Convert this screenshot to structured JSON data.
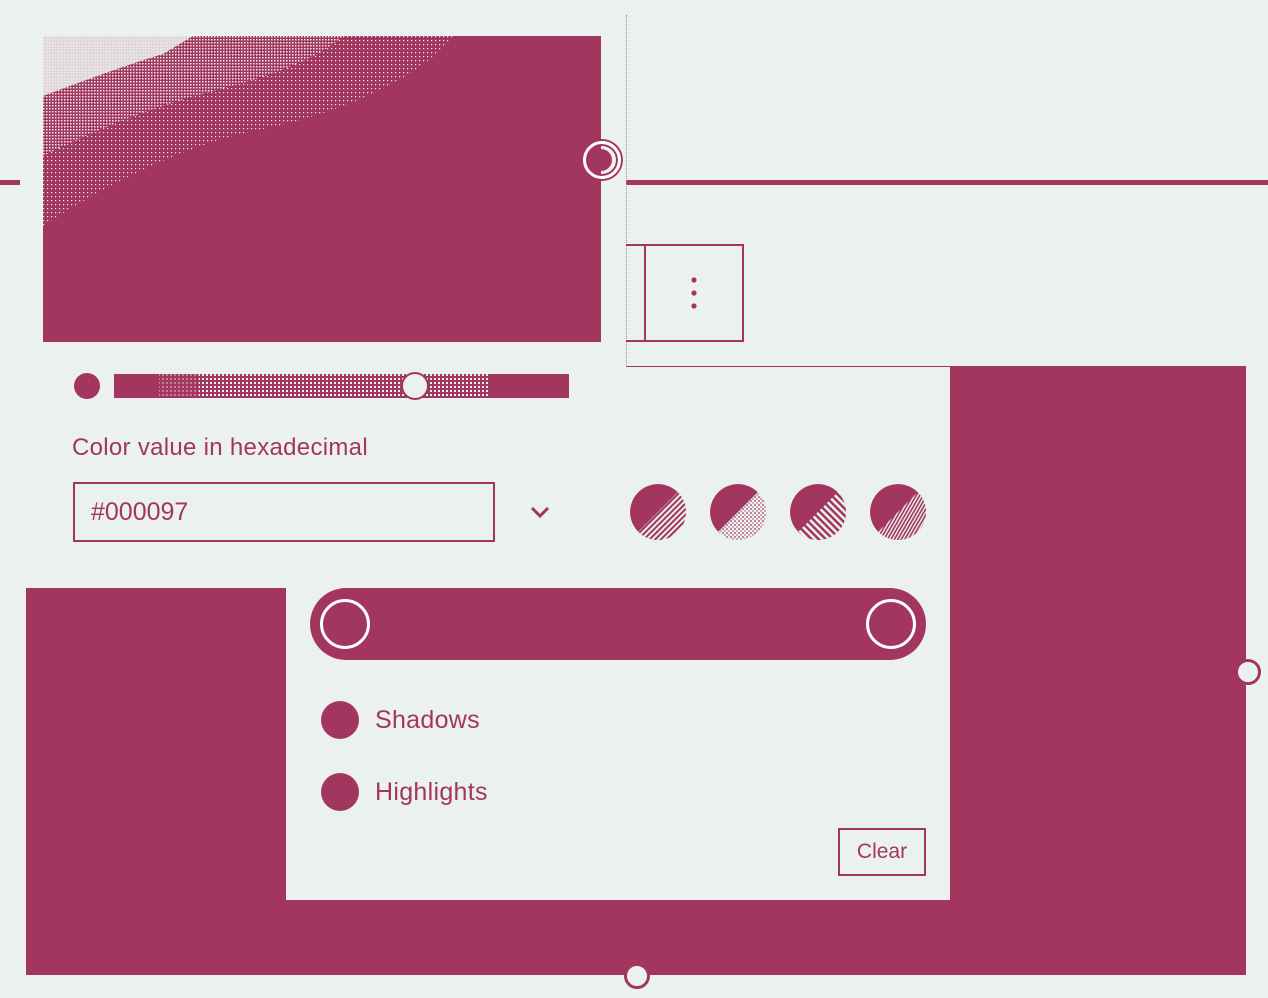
{
  "colors": {
    "accent": "#A3365F",
    "background": "#EBF1EF",
    "knob": "#FFFFFF"
  },
  "color_picker": {
    "hex_label": "Color value in hexadecimal",
    "hex_value": "#000097",
    "format_toggle_icon": "chevron-down-icon"
  },
  "toolbar": {
    "more_icon": "more-vertical-icon"
  },
  "duotone": {
    "presets": [
      {
        "icon": "duotone-swatch-1"
      },
      {
        "icon": "duotone-swatch-2"
      },
      {
        "icon": "duotone-swatch-3"
      },
      {
        "icon": "duotone-swatch-4"
      }
    ],
    "shadows_label": "Shadows",
    "highlights_label": "Highlights",
    "clear_label": "Clear"
  }
}
